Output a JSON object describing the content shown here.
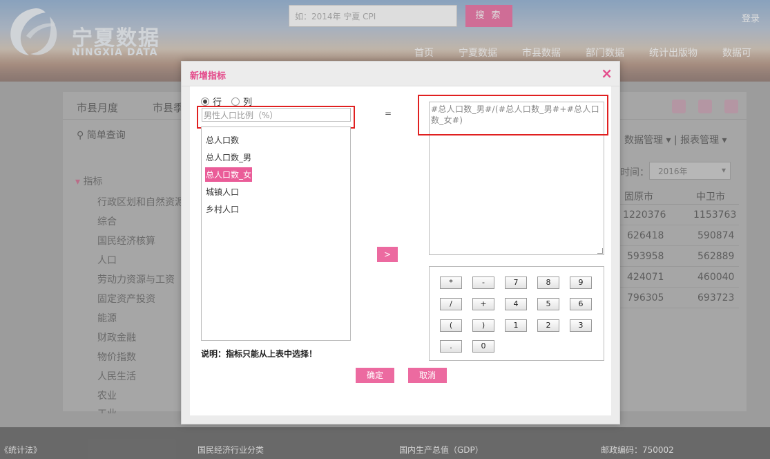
{
  "header": {
    "logo_cn": "宁夏数据",
    "logo_en": "NINGXIA DATA",
    "search_placeholder": "如：2014年 宁夏 CPI",
    "search_button": "搜 索",
    "login": "登录",
    "nav": [
      "首页",
      "宁夏数据",
      "市县数据",
      "部门数据",
      "统计出版物",
      "数据可"
    ]
  },
  "page": {
    "tabs": [
      "市县月度",
      "市县季"
    ],
    "simple_query": "简单查询",
    "data_management": "数据管理",
    "report_management": "报表管理",
    "tree_root": "指标",
    "tree_items": [
      "行政区划和自然资源",
      "综合",
      "国民经济核算",
      "人口",
      "劳动力资源与工资",
      "固定资产投资",
      "能源",
      "财政金融",
      "物价指数",
      "人民生活",
      "农业",
      "工业"
    ],
    "time_label": "时间：",
    "time_value": "2016年",
    "columns": [
      "固原市",
      "中卫市"
    ],
    "rows": [
      [
        "1220376",
        "1153763"
      ],
      [
        "626418",
        "590874"
      ],
      [
        "593958",
        "562889"
      ],
      [
        "424071",
        "460040"
      ],
      [
        "796305",
        "693723"
      ]
    ]
  },
  "footer": [
    "《统计法》",
    "国民经济行业分类",
    "国内生产总值（GDP）",
    "邮政编码：750002"
  ],
  "dialog": {
    "title": "新增指标",
    "close": "×",
    "radio_row": "行",
    "radio_col": "列",
    "name_value": "男性人口比例（%）",
    "indicators": [
      "总人口数",
      "总人口数_男",
      "总人口数_女",
      "城镇人口",
      "乡村人口"
    ],
    "selected_index": 2,
    "equals": "=",
    "add_button": ">",
    "formula": "#总人口数_男#/(#总人口数_男#+#总人口数_女#)",
    "keys": [
      "*",
      "-",
      "7",
      "8",
      "9",
      "/",
      "+",
      "4",
      "5",
      "6",
      "(",
      ")",
      "1",
      "2",
      "3",
      ".",
      "0"
    ],
    "note": "说明：指标只能从上表中选择！",
    "ok": "确定",
    "cancel": "取消"
  },
  "colors": {
    "accent": "#ec6aa0",
    "title": "#e44b8b",
    "highlight_box": "#e02020"
  }
}
